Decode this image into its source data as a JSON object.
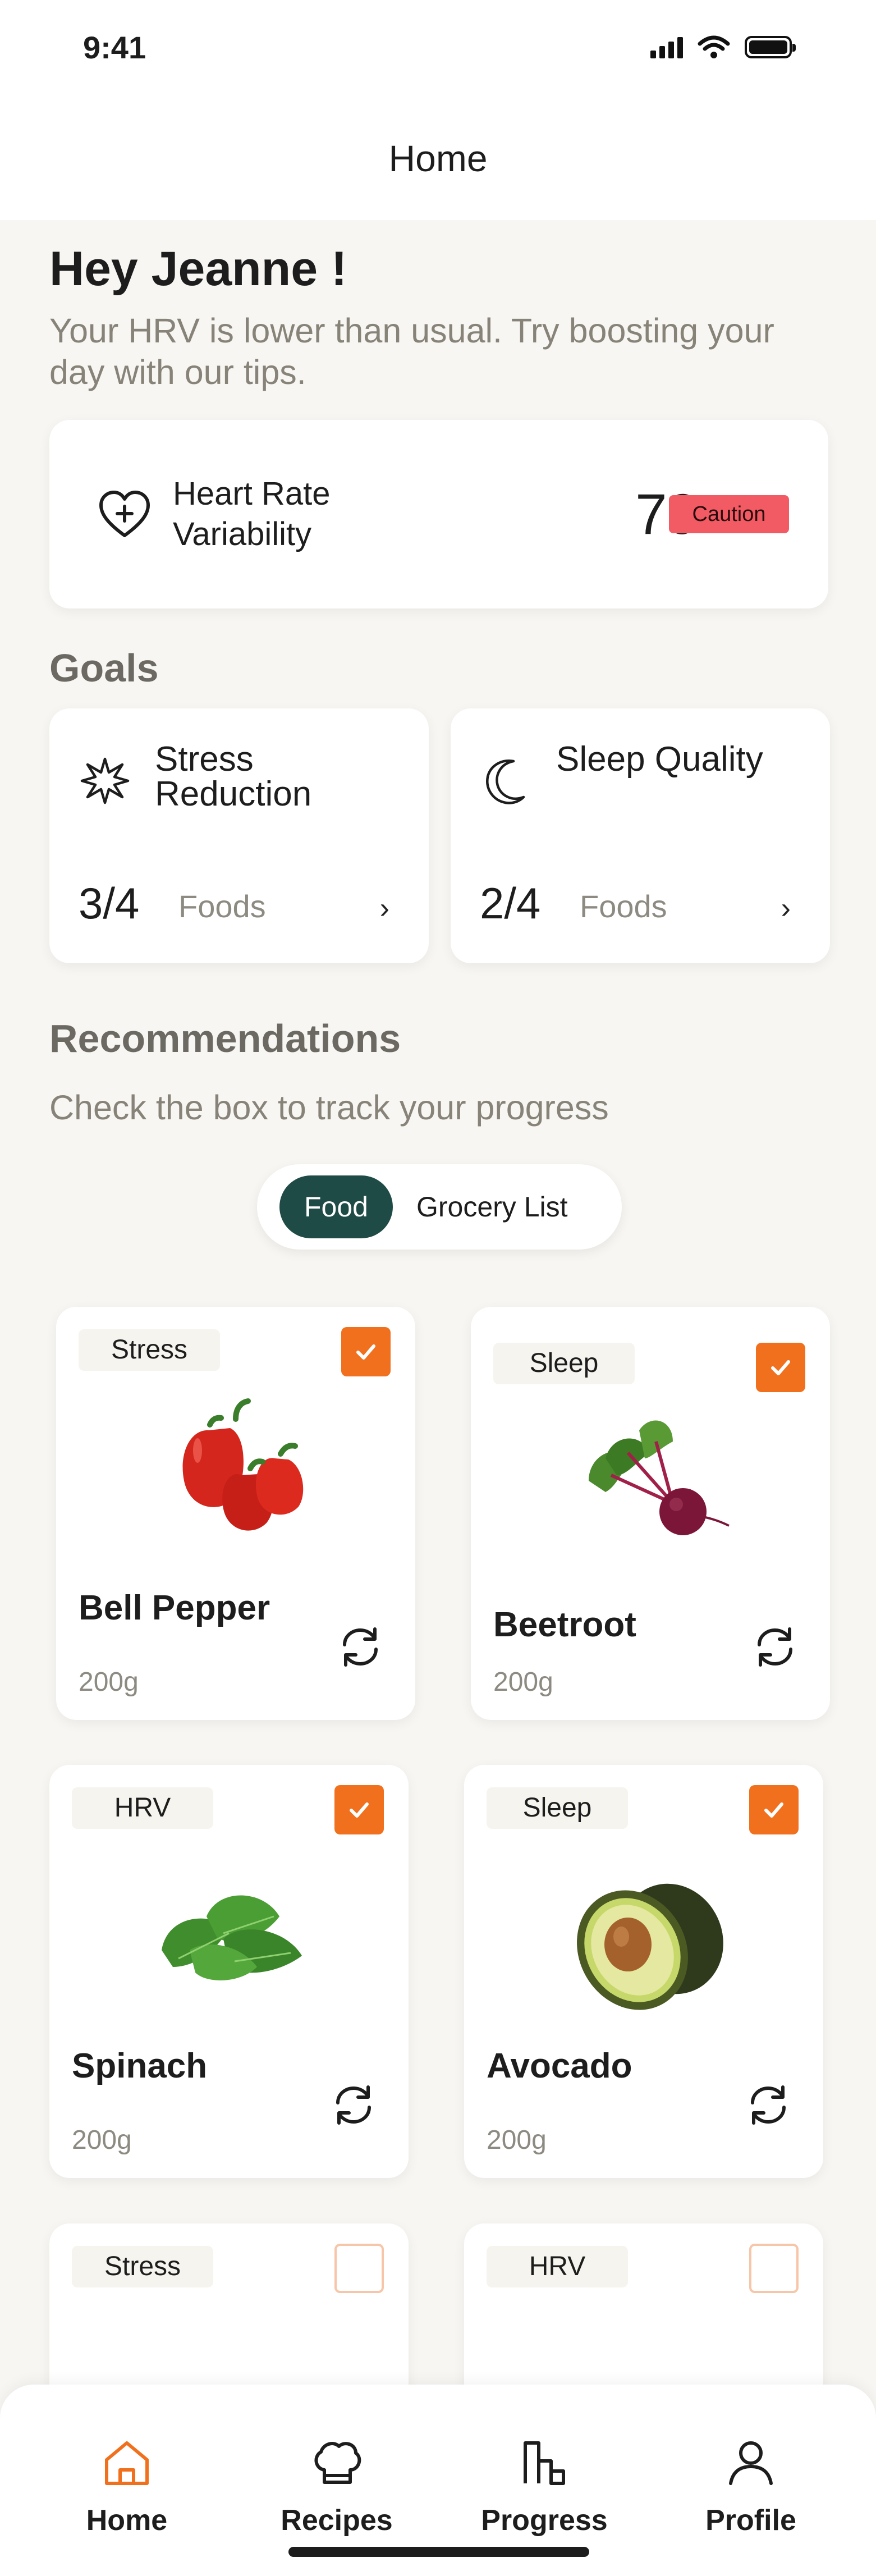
{
  "status_bar": {
    "time": "9:41"
  },
  "header": {
    "title": "Home"
  },
  "greeting": {
    "title": "Hey Jeanne !",
    "message": "Your HRV is lower than usual. Try boosting your day with our tips."
  },
  "hrv": {
    "label": "Heart Rate Variability",
    "value": "79",
    "status": "Caution",
    "status_color": "#f35b64"
  },
  "goals": {
    "title": "Goals",
    "items": [
      {
        "label": "Stress Reduction",
        "progress": "3/4",
        "unit": "Foods",
        "icon": "sparkle-icon"
      },
      {
        "label": "Sleep Quality",
        "progress": "2/4",
        "unit": "Foods",
        "icon": "moon-icon"
      }
    ]
  },
  "recommendations": {
    "title": "Recommendations",
    "subtitle": "Check the box to track your progress",
    "tabs": [
      {
        "label": "Food",
        "active": true
      },
      {
        "label": "Grocery List",
        "active": false
      }
    ],
    "foods": [
      {
        "tag": "Stress",
        "name": "Bell Pepper",
        "weight": "200g",
        "checked": true
      },
      {
        "tag": "Sleep",
        "name": "Beetroot",
        "weight": "200g",
        "checked": true
      },
      {
        "tag": "HRV",
        "name": "Spinach",
        "weight": "200g",
        "checked": true
      },
      {
        "tag": "Sleep",
        "name": "Avocado",
        "weight": "200g",
        "checked": true
      },
      {
        "tag": "Stress",
        "name": "",
        "weight": "",
        "checked": false
      },
      {
        "tag": "HRV",
        "name": "",
        "weight": "",
        "checked": false
      }
    ]
  },
  "bottom_nav": {
    "items": [
      {
        "label": "Home",
        "icon": "home-icon",
        "active": true
      },
      {
        "label": "Recipes",
        "icon": "chef-hat-icon",
        "active": false
      },
      {
        "label": "Progress",
        "icon": "progress-chart-icon",
        "active": false
      },
      {
        "label": "Profile",
        "icon": "user-icon",
        "active": false
      }
    ]
  },
  "colors": {
    "accent": "#f1701d",
    "primary": "#1f4b46",
    "background": "#f7f6f2"
  }
}
